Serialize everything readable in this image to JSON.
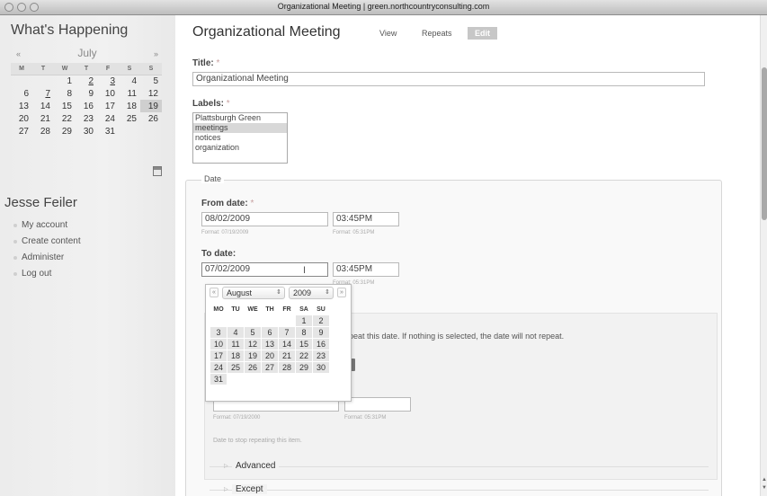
{
  "window": {
    "title": "Organizational Meeting | green.northcountryconsulting.com"
  },
  "sidebar": {
    "section_title": "What's Happening",
    "calendar": {
      "prev": "«",
      "month": "July",
      "next": "»",
      "weekdays": [
        "M",
        "T",
        "W",
        "T",
        "F",
        "S",
        "S"
      ],
      "weeks": [
        [
          "",
          "",
          "1",
          "2",
          "3",
          "4",
          "5"
        ],
        [
          "6",
          "7",
          "8",
          "9",
          "10",
          "11",
          "12"
        ],
        [
          "13",
          "14",
          "15",
          "16",
          "17",
          "18",
          "19"
        ],
        [
          "20",
          "21",
          "22",
          "23",
          "24",
          "25",
          "26"
        ],
        [
          "27",
          "28",
          "29",
          "30",
          "31",
          "",
          ""
        ]
      ],
      "linked_days": [
        "2",
        "3",
        "7"
      ],
      "today": "19",
      "icon": "calendar-icon"
    },
    "user_name": "Jesse Feiler",
    "user_menu": [
      "My account",
      "Create content",
      "Administer",
      "Log out"
    ]
  },
  "main": {
    "page_title": "Organizational Meeting",
    "tabs": [
      "View",
      "Repeats",
      "Edit"
    ],
    "active_tab": "Edit",
    "title_label": "Title:",
    "required_mark": "*",
    "title_value": "Organizational Meeting",
    "labels_label": "Labels:",
    "labels_options": [
      "Plattsburgh Green",
      "meetings",
      "notices",
      "organization"
    ],
    "labels_selected": [
      "meetings"
    ],
    "date_legend": "Date",
    "from_label": "From date:",
    "from_date": "08/02/2009",
    "from_time": "03:45PM",
    "from_date_hint": "Format: 07/19/2009",
    "from_time_hint": "Format: 05:31PM",
    "to_label": "To date:",
    "to_date": "07/02/2009",
    "to_time": "03:45PM",
    "to_time_hint": "Format: 05:31PM",
    "repeat_desc": "to repeat this date. If nothing is selected, the date will not repeat.",
    "until_date_hint": "Format: 07/19/2000",
    "until_time_hint": "Format: 05:31PM",
    "until_desc": "Date to stop repeating this item.",
    "advanced_label": "Advanced",
    "except_label": "Except"
  },
  "datepicker": {
    "prev": "«",
    "month": "August",
    "year": "2009",
    "next": "»",
    "weekdays": [
      "MO",
      "TU",
      "WE",
      "TH",
      "FR",
      "SA",
      "SU"
    ],
    "weeks": [
      [
        "",
        "",
        "",
        "",
        "",
        "1",
        "2"
      ],
      [
        "3",
        "4",
        "5",
        "6",
        "7",
        "8",
        "9"
      ],
      [
        "10",
        "11",
        "12",
        "13",
        "14",
        "15",
        "16"
      ],
      [
        "17",
        "18",
        "19",
        "20",
        "21",
        "22",
        "23"
      ],
      [
        "24",
        "25",
        "26",
        "27",
        "28",
        "29",
        "30"
      ],
      [
        "31",
        "",
        "",
        "",
        "",
        "",
        ""
      ]
    ]
  },
  "colors": {
    "tab_active_bg": "#c7c7c7",
    "sidebar_bg": "#ececec"
  }
}
